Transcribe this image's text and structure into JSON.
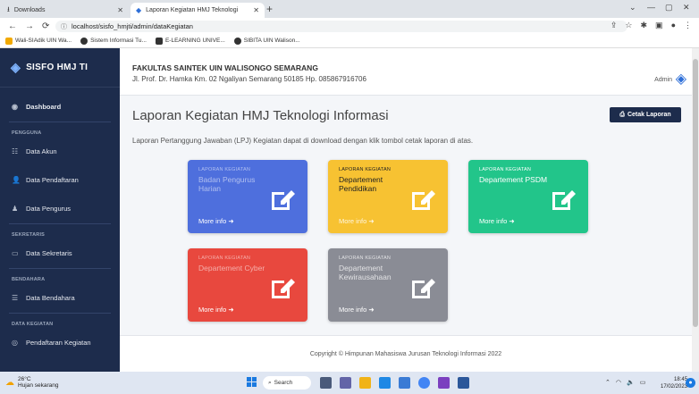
{
  "browser": {
    "tabs": [
      {
        "label": "Downloads",
        "icon": "download-icon"
      },
      {
        "label": "Laporan Kegiatan HMJ Teknologi",
        "icon": "site-logo-icon"
      }
    ],
    "url": "localhost/sisfo_hmjti/admin/dataKegiatan",
    "bookmarks": [
      "Wali-SIAdik UIN Wa...",
      "Sistem Informasi Tu...",
      "E-LEARNING UNIVE...",
      "SIBITA UIN Walison..."
    ]
  },
  "sidebar": {
    "brand": "SISFO HMJ TI",
    "items": [
      {
        "type": "item",
        "label": "Dashboard",
        "icon": "dashboard-icon",
        "bold": true
      },
      {
        "type": "head",
        "label": "PENGGUNA"
      },
      {
        "type": "item",
        "label": "Data Akun",
        "icon": "users-icon"
      },
      {
        "type": "item",
        "label": "Data Pendaftaran",
        "icon": "user-plus-icon"
      },
      {
        "type": "item",
        "label": "Data Pengurus",
        "icon": "user-icon"
      },
      {
        "type": "head",
        "label": "SEKRETARIS"
      },
      {
        "type": "item",
        "label": "Data Sekretaris",
        "icon": "inbox-icon"
      },
      {
        "type": "head",
        "label": "BENDAHARA"
      },
      {
        "type": "item",
        "label": "Data Bendahara",
        "icon": "list-icon"
      },
      {
        "type": "head",
        "label": "DATA KEGIATAN"
      },
      {
        "type": "item",
        "label": "Pendaftaran Kegiatan",
        "icon": "circle-icon"
      }
    ]
  },
  "header": {
    "faculty": "FAKULTAS SAINTEK UIN WALISONGO SEMARANG",
    "address": "Jl. Prof. Dr. Hamka Km. 02 Ngaliyan Semarang 50185 Hp. 085867916706",
    "user": "Admin"
  },
  "main": {
    "title": "Laporan Kegiatan HMJ Teknologi Informasi",
    "print_button": "Cetak Laporan",
    "description": "Laporan Pertanggung Jawaban (LPJ) Kegiatan dapat di download dengan klik tombol cetak laporan di atas.",
    "cards": [
      {
        "label": "LAPORAN KEGIATAN",
        "title": "Badan Pengurus Harian",
        "more": "More info",
        "color": "#4e6fdd"
      },
      {
        "label": "LAPORAN KEGIATAN",
        "title": "Departement Pendidikan",
        "more": "More info",
        "color": "#f7c232"
      },
      {
        "label": "LAPORAN KEGIATAN",
        "title": "Departement PSDM",
        "more": "More info",
        "color": "#22c58a"
      },
      {
        "label": "LAPORAN KEGIATAN",
        "title": "Departement Cyber",
        "more": "More info",
        "color": "#e8483e"
      },
      {
        "label": "LAPORAN KEGIATAN",
        "title": "Departement Kewirausahaan",
        "more": "More info",
        "color": "#8a8c95"
      }
    ],
    "footer": "Copyright © Himpunan Mahasiswa Jurusan Teknologi Informasi 2022"
  },
  "taskbar": {
    "weather_temp": "26°C",
    "weather_text": "Hujan sekarang",
    "search": "Search",
    "time": "18:45",
    "date": "17/02/2023"
  }
}
